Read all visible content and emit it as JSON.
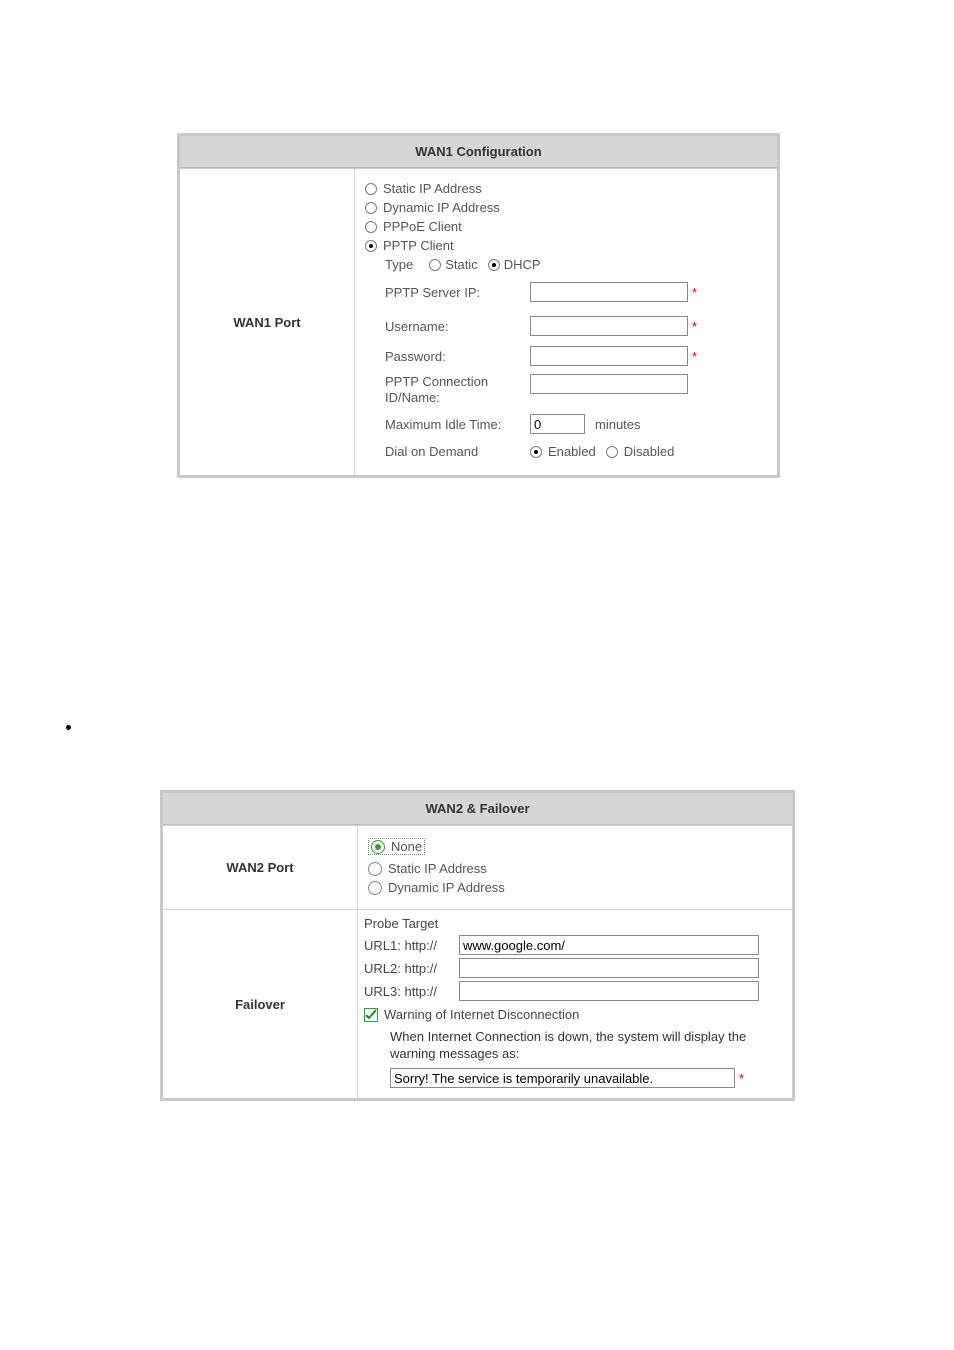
{
  "wan1": {
    "header": "WAN1 Configuration",
    "row_label": "WAN1 Port",
    "mode_options": {
      "static": "Static IP Address",
      "dynamic": "Dynamic IP Address",
      "pppoe": "PPPoE Client",
      "pptp": "PPTP Client"
    },
    "pptp": {
      "type_label": "Type",
      "type_static": "Static",
      "type_dhcp": "DHCP",
      "server_ip_label": "PPTP Server IP:",
      "server_ip_value": "",
      "username_label": "Username:",
      "username_value": "",
      "password_label": "Password:",
      "password_value": "",
      "conn_id_label": "PPTP Connection ID/Name:",
      "conn_id_value": "",
      "idle_label": "Maximum Idle Time:",
      "idle_value": "0",
      "idle_unit": "minutes",
      "dial_label": "Dial on Demand",
      "enabled": "Enabled",
      "disabled": "Disabled"
    }
  },
  "wan2": {
    "header": "WAN2 & Failover",
    "row_label": "WAN2 Port",
    "mode_options": {
      "none": "None",
      "static": "Static IP Address",
      "dynamic": "Dynamic IP Address"
    },
    "failover": {
      "row_label": "Failover",
      "probe": "Probe Target",
      "url1_label": "URL1: http://",
      "url1_value": "www.google.com/",
      "url2_label": "URL2: http://",
      "url2_value": "",
      "url3_label": "URL3: http://",
      "url3_value": "",
      "warn_check_label": "Warning of Internet Disconnection",
      "warn_desc": "When Internet Connection is down, the system will display the warning messages as:",
      "warn_msg_value": "Sorry! The service is temporarily unavailable."
    }
  }
}
